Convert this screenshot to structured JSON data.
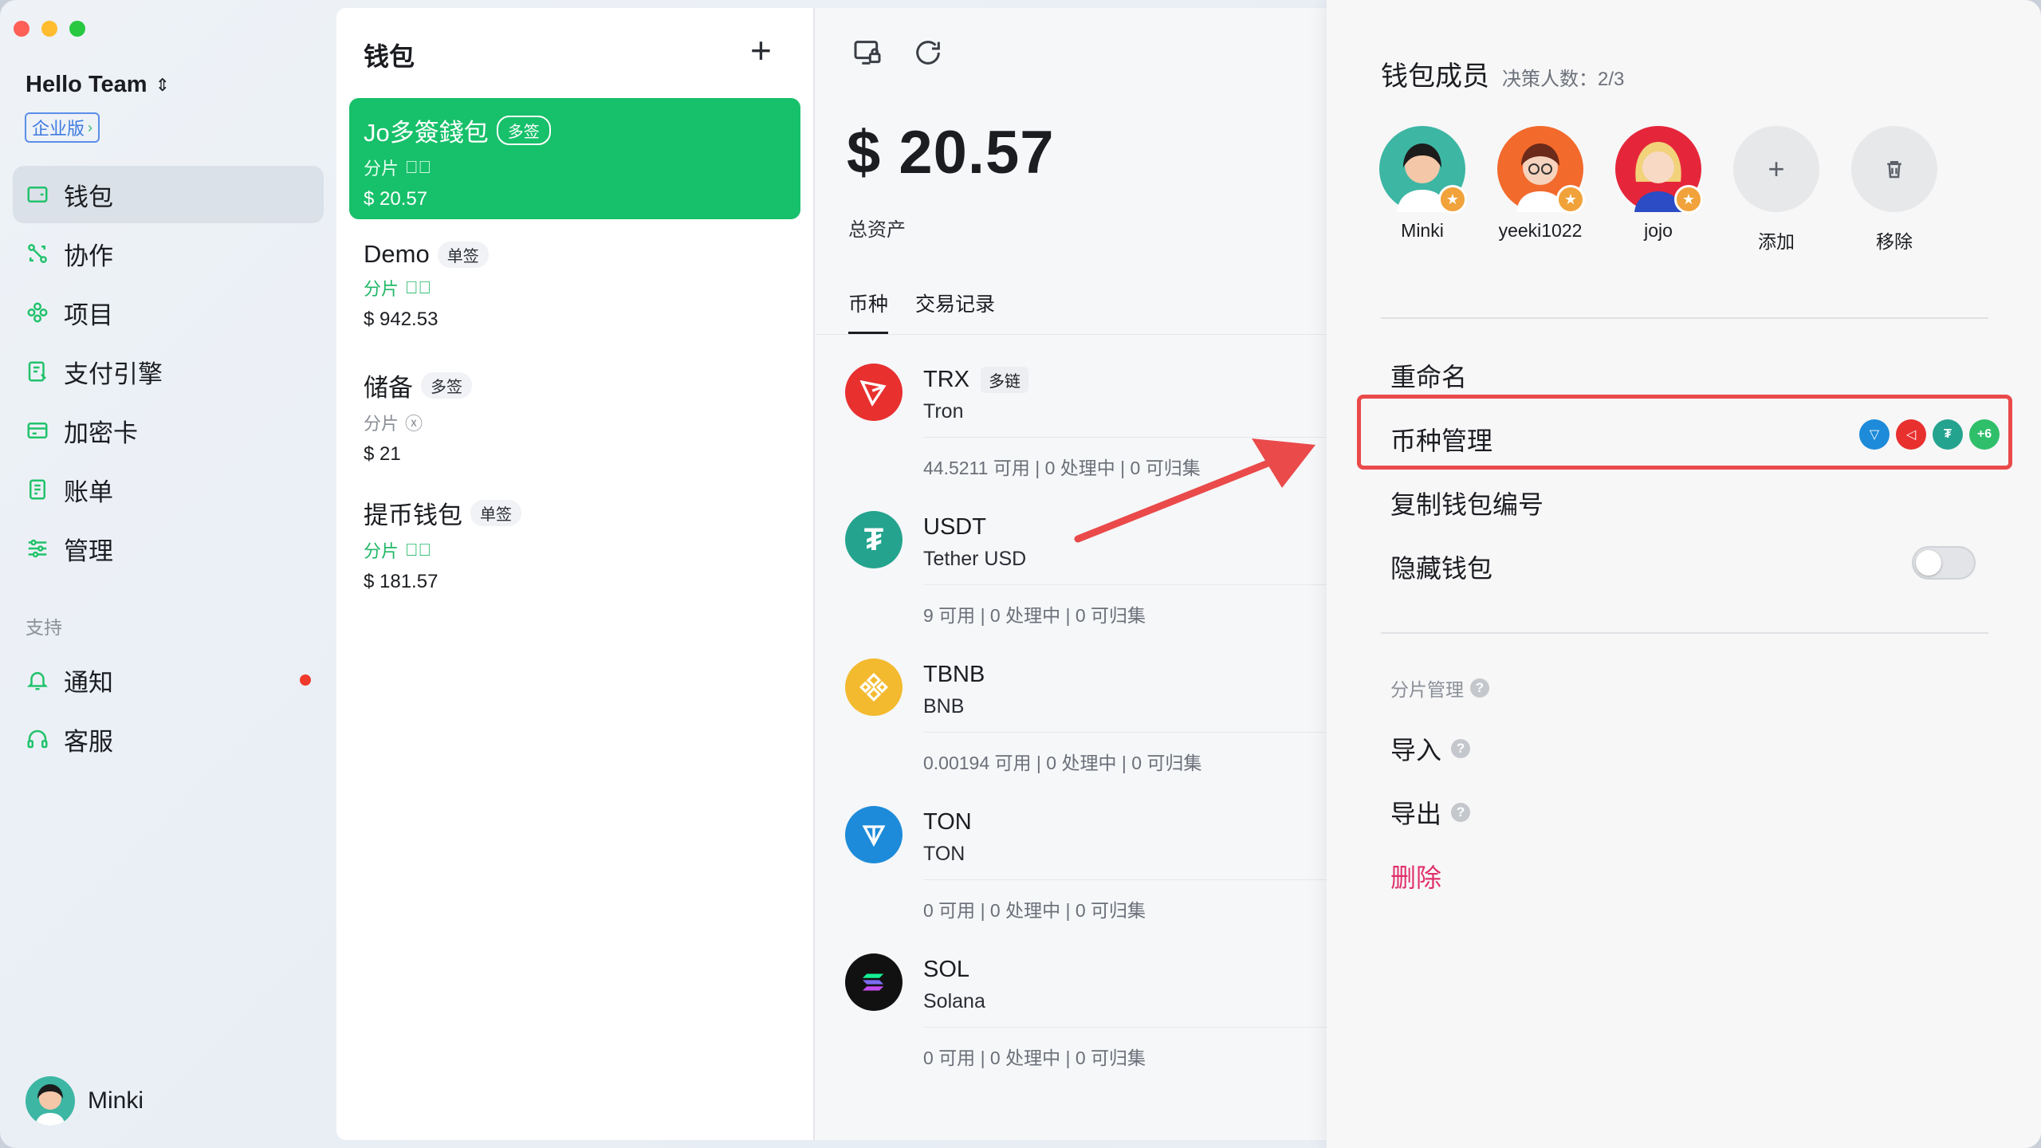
{
  "sidebar": {
    "team_name": "Hello Team",
    "edition": "企业版",
    "nav": [
      {
        "label": "钱包",
        "icon": "wallet-icon",
        "active": true
      },
      {
        "label": "协作",
        "icon": "collaborate-icon"
      },
      {
        "label": "项目",
        "icon": "project-icon"
      },
      {
        "label": "支付引擎",
        "icon": "payment-engine-icon"
      },
      {
        "label": "加密卡",
        "icon": "crypto-card-icon"
      },
      {
        "label": "账单",
        "icon": "bill-icon"
      },
      {
        "label": "管理",
        "icon": "settings-sliders-icon"
      }
    ],
    "support_label": "支持",
    "support_nav": [
      {
        "label": "通知",
        "icon": "bell-icon",
        "has_dot": true
      },
      {
        "label": "客服",
        "icon": "headset-icon"
      }
    ],
    "user_name": "Minki"
  },
  "wallets": {
    "title": "钱包",
    "items": [
      {
        "name": "Jo多簽錢包",
        "tag": "多签",
        "sub": "分片",
        "status": "check",
        "amount": "$ 20.57",
        "active": true
      },
      {
        "name": "Demo",
        "tag": "单签",
        "sub": "分片",
        "status": "check",
        "amount": "$ 942.53"
      },
      {
        "name": "储备",
        "tag": "多签",
        "sub": "分片",
        "status": "x",
        "amount": "$ 21"
      },
      {
        "name": "提币钱包",
        "tag": "单签",
        "sub": "分片",
        "status": "check",
        "amount": "$ 181.57"
      }
    ]
  },
  "main": {
    "total": "$ 20.57",
    "total_label": "总资产",
    "tabs": [
      "币种",
      "交易记录"
    ],
    "coins": [
      {
        "symbol": "TRX",
        "chain_tag": "多链",
        "name": "Tron",
        "balance": "44.5211 可用 | 0 处理中 | 0 可归集",
        "color": "#e8302f"
      },
      {
        "symbol": "USDT",
        "chain_tag": "",
        "name": "Tether USD",
        "balance": "9 可用 | 0 处理中 | 0 可归集",
        "color": "#24a38e"
      },
      {
        "symbol": "TBNB",
        "chain_tag": "",
        "name": "BNB",
        "balance": "0.00194 可用 | 0 处理中 | 0 可归集",
        "color": "#f3ba2f"
      },
      {
        "symbol": "TON",
        "chain_tag": "",
        "name": "TON",
        "balance": "0 可用 | 0 处理中 | 0 可归集",
        "color": "#1d8bd9"
      },
      {
        "symbol": "SOL",
        "chain_tag": "",
        "name": "Solana",
        "balance": "0 可用 | 0 处理中 | 0 可归集",
        "color": "#111111"
      }
    ]
  },
  "drawer": {
    "title": "钱包成员",
    "quorum": "决策人数：2/3",
    "members": [
      {
        "name": "Minki",
        "color": "#3db6a4"
      },
      {
        "name": "yeeki1022",
        "color": "#f26a2c"
      },
      {
        "name": "jojo",
        "color": "#e5263a"
      }
    ],
    "add_label": "添加",
    "remove_label": "移除",
    "rename": "重命名",
    "coin_manage": "币种管理",
    "coin_more": "+6",
    "copy_id": "复制钱包编号",
    "hide_wallet": "隐藏钱包",
    "hide_wallet_on": false,
    "shard_section": "分片管理",
    "import": "导入",
    "export": "导出",
    "delete": "删除"
  },
  "colors": {
    "accent": "#17c06a",
    "highlight": "#ea4a4a",
    "delete": "#e0306b"
  }
}
